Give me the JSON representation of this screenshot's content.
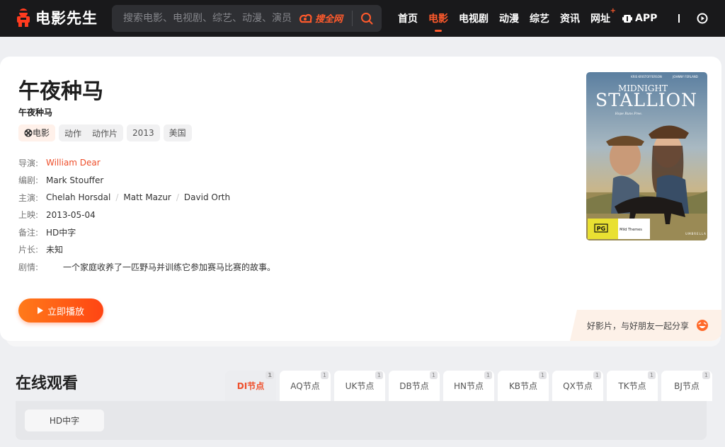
{
  "header": {
    "logo_text": "电影先生",
    "search_placeholder": "搜索电影、电视剧、综艺、动漫、演员",
    "search_engine": "搜全网",
    "nav": [
      {
        "label": "首页",
        "active": false
      },
      {
        "label": "电影",
        "active": true
      },
      {
        "label": "电视剧",
        "active": false
      },
      {
        "label": "动漫",
        "active": false
      },
      {
        "label": "综艺",
        "active": false
      },
      {
        "label": "资讯",
        "active": false
      },
      {
        "label": "网址",
        "active": false,
        "badge": "+"
      }
    ],
    "app_label": "APP"
  },
  "movie": {
    "title": "午夜种马",
    "subtitle": "午夜种马",
    "type_tag": "电影",
    "genres": [
      "动作",
      "动作片"
    ],
    "year": "2013",
    "region": "美国",
    "labels": {
      "director": "导演:",
      "writer": "编剧:",
      "cast": "主演:",
      "release": "上映:",
      "note": "备注:",
      "runtime": "片长:",
      "plot": "剧情:"
    },
    "director": "William Dear",
    "writer": "Mark Stouffer",
    "cast": [
      "Chelah Horsdal",
      "Matt Mazur",
      "David Orth"
    ],
    "release": "2013-05-04",
    "note": "HD中字",
    "runtime": "未知",
    "plot": "一个家庭收养了一匹野马并训练它参加赛马比赛的故事。",
    "play_label": "立即播放",
    "share_text": "好影片，与好朋友一起分享",
    "poster": {
      "actors_top": "KRIS KRISTOFFERSON",
      "actors_top_right": "JOHNNY FERLAND",
      "title_line1": "MIDNIGHT",
      "title_line2": "STALLION",
      "tagline": "Hope Runs Free.",
      "rating": "PG",
      "rating_note": "Mild Themes",
      "studio": "UMBRELLA"
    }
  },
  "online": {
    "title": "在线观看",
    "tabs": [
      {
        "label": "DI节点",
        "count": "1",
        "active": true
      },
      {
        "label": "AQ节点",
        "count": "1",
        "active": false
      },
      {
        "label": "UK节点",
        "count": "1",
        "active": false
      },
      {
        "label": "DB节点",
        "count": "1",
        "active": false
      },
      {
        "label": "HN节点",
        "count": "1",
        "active": false
      },
      {
        "label": "KB节点",
        "count": "1",
        "active": false
      },
      {
        "label": "QX节点",
        "count": "1",
        "active": false
      },
      {
        "label": "TK节点",
        "count": "1",
        "active": false
      },
      {
        "label": "BJ节点",
        "count": "1",
        "active": false
      }
    ],
    "episodes": [
      "HD中字"
    ]
  },
  "colors": {
    "accent": "#ff5a2c",
    "header_bg": "#19191b",
    "link": "#ee4e2a"
  }
}
